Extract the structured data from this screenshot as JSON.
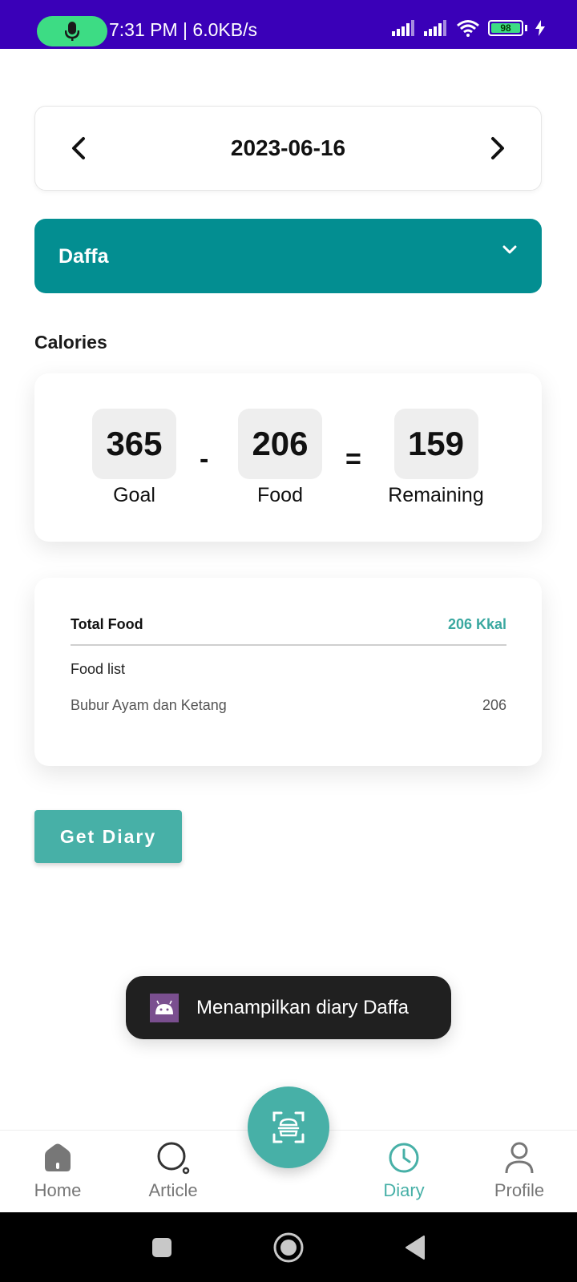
{
  "status_bar": {
    "time_speed": "7:31 PM | 6.0KB/s",
    "battery": "98",
    "icons": [
      "mic-icon",
      "signal-icon",
      "signal-icon",
      "wifi-icon",
      "battery-icon",
      "charging-icon"
    ],
    "accent": "#3a00b8"
  },
  "date_nav": {
    "date": "2023-06-16",
    "prev_icon": "chevron-left-icon",
    "next_icon": "chevron-right-icon"
  },
  "user_select": {
    "selected": "Daffa",
    "icon": "chevron-down-icon",
    "color": "#038e91"
  },
  "calories": {
    "title": "Calories",
    "goal_value": "365",
    "goal_label": "Goal",
    "minus": "-",
    "food_value": "206",
    "food_label": "Food",
    "equals": "=",
    "remaining_value": "159",
    "remaining_label": "Remaining"
  },
  "food_summary": {
    "total_label": "Total Food",
    "total_value": "206 Kkal",
    "list_label": "Food list",
    "items": [
      {
        "name": "Bubur Ayam dan Ketang",
        "calories": "206"
      }
    ]
  },
  "actions": {
    "get_diary": "Get Diary"
  },
  "toast": {
    "icon": "android-icon",
    "message": "Menampilkan diary Daffa"
  },
  "bottom_nav": {
    "items": [
      {
        "label": "Home",
        "icon": "home-icon"
      },
      {
        "label": "Article",
        "icon": "search-icon"
      },
      {
        "label": "Diary",
        "icon": "clock-icon",
        "active": true
      },
      {
        "label": "Profile",
        "icon": "person-icon"
      }
    ],
    "fab_icon": "scan-food-icon",
    "accent": "#47b0a7"
  },
  "system_nav": {
    "icons": [
      "recents-icon",
      "home-circle-icon",
      "back-icon"
    ]
  }
}
